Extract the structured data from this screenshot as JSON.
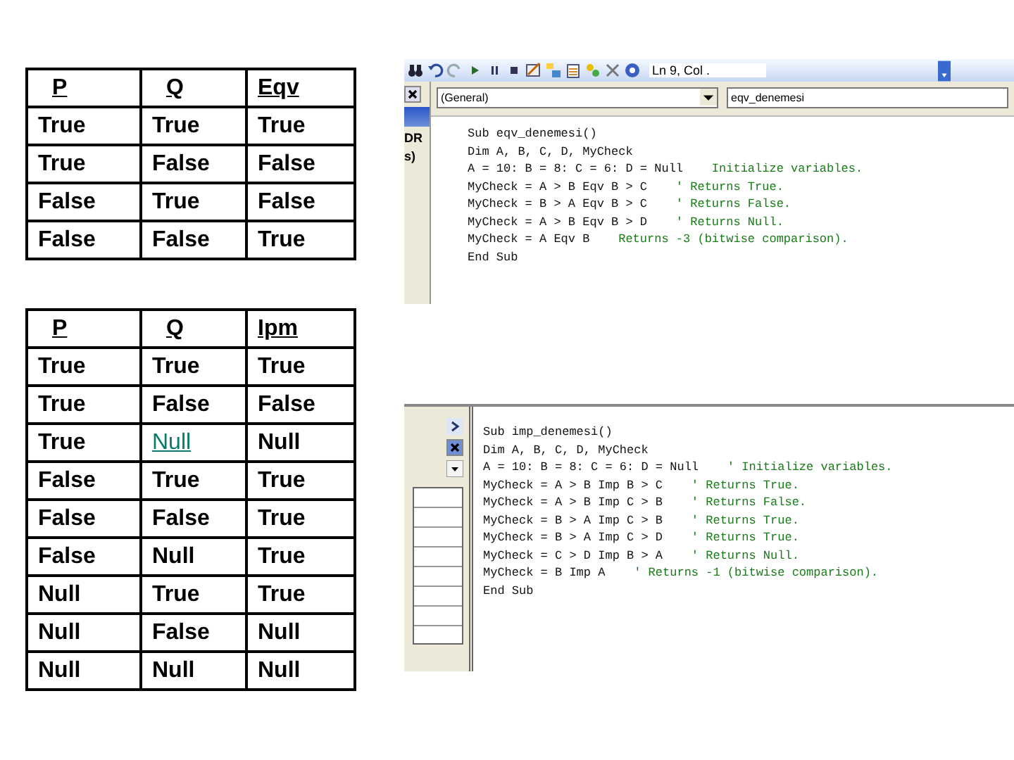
{
  "tables": [
    {
      "columns": [
        "P",
        "Q",
        "Eqv"
      ],
      "rows": [
        [
          {
            "text": "True",
            "marked": false
          },
          {
            "text": "True",
            "marked": false
          },
          {
            "text": "True",
            "marked": false
          }
        ],
        [
          {
            "text": "True",
            "marked": false
          },
          {
            "text": "False",
            "marked": false
          },
          {
            "text": "False",
            "marked": false
          }
        ],
        [
          {
            "text": "False",
            "marked": false
          },
          {
            "text": "True",
            "marked": false
          },
          {
            "text": "False",
            "marked": false
          }
        ],
        [
          {
            "text": "False",
            "marked": false
          },
          {
            "text": "False",
            "marked": false
          },
          {
            "text": "True",
            "marked": false
          }
        ]
      ]
    },
    {
      "columns": [
        "P",
        "Q",
        "Ipm"
      ],
      "rows": [
        [
          {
            "text": "True",
            "marked": false
          },
          {
            "text": "True",
            "marked": false
          },
          {
            "text": "True",
            "marked": false
          }
        ],
        [
          {
            "text": "True",
            "marked": false
          },
          {
            "text": "False",
            "marked": false
          },
          {
            "text": "False",
            "marked": false
          }
        ],
        [
          {
            "text": "True",
            "marked": false
          },
          {
            "text": "Null",
            "marked": true
          },
          {
            "text": "Null",
            "marked": false
          }
        ],
        [
          {
            "text": "False",
            "marked": false
          },
          {
            "text": "True",
            "marked": false
          },
          {
            "text": "True",
            "marked": false
          }
        ],
        [
          {
            "text": "False",
            "marked": false
          },
          {
            "text": "False",
            "marked": false
          },
          {
            "text": "True",
            "marked": false
          }
        ],
        [
          {
            "text": "False",
            "marked": false
          },
          {
            "text": "Null",
            "marked": false
          },
          {
            "text": "True",
            "marked": false
          }
        ],
        [
          {
            "text": "Null",
            "marked": false
          },
          {
            "text": "True",
            "marked": false
          },
          {
            "text": "True",
            "marked": false
          }
        ],
        [
          {
            "text": "Null",
            "marked": false
          },
          {
            "text": "False",
            "marked": false
          },
          {
            "text": "Null",
            "marked": false
          }
        ],
        [
          {
            "text": "Null",
            "marked": false
          },
          {
            "text": "Null",
            "marked": false
          },
          {
            "text": "Null",
            "marked": false
          }
        ]
      ]
    }
  ],
  "code_windows": [
    {
      "toolbar": {
        "position": "Ln 9, Col ."
      },
      "object_box": "(General)",
      "procedure_box": "eqv_denemesi",
      "side_texts": [
        "DR",
        "s)"
      ],
      "lines": [
        {
          "code": "Sub eqv_denemesi()"
        },
        {
          "code": "Dim A, B, C, D, MyCheck"
        },
        {
          "code": "A = 10: B = 8: C = 6: D = Null",
          "comment": "Initialize variables."
        },
        {
          "code": "MyCheck = A > B Eqv B > C",
          "comment": "' Returns True."
        },
        {
          "code": "MyCheck = B > A Eqv B > C",
          "comment": "' Returns False."
        },
        {
          "code": "MyCheck = A > B Eqv B > D",
          "comment": "' Returns Null."
        },
        {
          "code": "MyCheck = A Eqv B",
          "comment": "Returns -3 (bitwise comparison)."
        },
        {
          "code": "End Sub"
        }
      ]
    },
    {
      "lines": [
        {
          "code": "Sub imp_denemesi()"
        },
        {
          "code": "Dim A, B, C, D, MyCheck"
        },
        {
          "code": "A = 10: B = 8: C = 6: D = Null",
          "comment": "' Initialize variables."
        },
        {
          "code": "MyCheck = A > B Imp B > C",
          "comment": "' Returns True."
        },
        {
          "code": "MyCheck = A > B Imp C > B",
          "comment": "' Returns False."
        },
        {
          "code": "MyCheck = B > A Imp C > B",
          "comment": "' Returns True."
        },
        {
          "code": "MyCheck = B > A Imp C > D",
          "comment": "' Returns True."
        },
        {
          "code": "MyCheck = C > D Imp B > A",
          "comment": "' Returns Null."
        },
        {
          "code": "MyCheck = B Imp A",
          "comment": "' Returns -1 (bitwise comparison)."
        },
        {
          "code": "End Sub"
        }
      ]
    }
  ]
}
